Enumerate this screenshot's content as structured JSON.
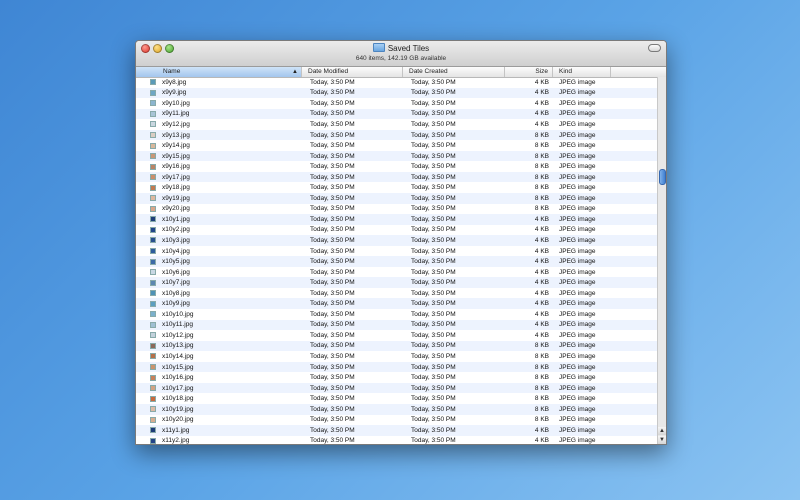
{
  "window": {
    "title": "Saved Tiles",
    "status": "640 items, 142.19 GB available"
  },
  "columns": {
    "name": "Name",
    "modified": "Date Modified",
    "created": "Date Created",
    "size": "Size",
    "kind": "Kind"
  },
  "rows": [
    {
      "name": "x9y8.jpg",
      "modified": "Today, 3:50 PM",
      "created": "Today, 3:50 PM",
      "size": "4 KB",
      "kind": "JPEG image",
      "color": "#5a9ab8"
    },
    {
      "name": "x9y9.jpg",
      "modified": "Today, 3:50 PM",
      "created": "Today, 3:50 PM",
      "size": "4 KB",
      "kind": "JPEG image",
      "color": "#6ea7c4"
    },
    {
      "name": "x9y10.jpg",
      "modified": "Today, 3:50 PM",
      "created": "Today, 3:50 PM",
      "size": "4 KB",
      "kind": "JPEG image",
      "color": "#8bb5cf"
    },
    {
      "name": "x9y11.jpg",
      "modified": "Today, 3:50 PM",
      "created": "Today, 3:50 PM",
      "size": "4 KB",
      "kind": "JPEG image",
      "color": "#a8c4d6"
    },
    {
      "name": "x9y12.jpg",
      "modified": "Today, 3:50 PM",
      "created": "Today, 3:50 PM",
      "size": "4 KB",
      "kind": "JPEG image",
      "color": "#c9d6df"
    },
    {
      "name": "x9y13.jpg",
      "modified": "Today, 3:50 PM",
      "created": "Today, 3:50 PM",
      "size": "8 KB",
      "kind": "JPEG image",
      "color": "#d9cdc3"
    },
    {
      "name": "x9y14.jpg",
      "modified": "Today, 3:50 PM",
      "created": "Today, 3:50 PM",
      "size": "8 KB",
      "kind": "JPEG image",
      "color": "#d7b89c"
    },
    {
      "name": "x9y15.jpg",
      "modified": "Today, 3:50 PM",
      "created": "Today, 3:50 PM",
      "size": "8 KB",
      "kind": "JPEG image",
      "color": "#c79878"
    },
    {
      "name": "x9y16.jpg",
      "modified": "Today, 3:50 PM",
      "created": "Today, 3:50 PM",
      "size": "8 KB",
      "kind": "JPEG image",
      "color": "#b98466"
    },
    {
      "name": "x9y17.jpg",
      "modified": "Today, 3:50 PM",
      "created": "Today, 3:50 PM",
      "size": "8 KB",
      "kind": "JPEG image",
      "color": "#c98e6c"
    },
    {
      "name": "x9y18.jpg",
      "modified": "Today, 3:50 PM",
      "created": "Today, 3:50 PM",
      "size": "8 KB",
      "kind": "JPEG image",
      "color": "#c07a52"
    },
    {
      "name": "x9y19.jpg",
      "modified": "Today, 3:50 PM",
      "created": "Today, 3:50 PM",
      "size": "8 KB",
      "kind": "JPEG image",
      "color": "#dcb8a0"
    },
    {
      "name": "x9y20.jpg",
      "modified": "Today, 3:50 PM",
      "created": "Today, 3:50 PM",
      "size": "8 KB",
      "kind": "JPEG image",
      "color": "#d9a68a"
    },
    {
      "name": "x10y1.jpg",
      "modified": "Today, 3:50 PM",
      "created": "Today, 3:50 PM",
      "size": "4 KB",
      "kind": "JPEG image",
      "color": "#1f3f7a"
    },
    {
      "name": "x10y2.jpg",
      "modified": "Today, 3:50 PM",
      "created": "Today, 3:50 PM",
      "size": "4 KB",
      "kind": "JPEG image",
      "color": "#22468a"
    },
    {
      "name": "x10y3.jpg",
      "modified": "Today, 3:50 PM",
      "created": "Today, 3:50 PM",
      "size": "4 KB",
      "kind": "JPEG image",
      "color": "#28508f"
    },
    {
      "name": "x10y4.jpg",
      "modified": "Today, 3:50 PM",
      "created": "Today, 3:50 PM",
      "size": "4 KB",
      "kind": "JPEG image",
      "color": "#2e5d9c"
    },
    {
      "name": "x10y5.jpg",
      "modified": "Today, 3:50 PM",
      "created": "Today, 3:50 PM",
      "size": "4 KB",
      "kind": "JPEG image",
      "color": "#3b6aa6"
    },
    {
      "name": "x10y6.jpg",
      "modified": "Today, 3:50 PM",
      "created": "Today, 3:50 PM",
      "size": "4 KB",
      "kind": "JPEG image",
      "color": "#c8d8e4"
    },
    {
      "name": "x10y7.jpg",
      "modified": "Today, 3:50 PM",
      "created": "Today, 3:50 PM",
      "size": "4 KB",
      "kind": "JPEG image",
      "color": "#5d88b0"
    },
    {
      "name": "x10y8.jpg",
      "modified": "Today, 3:50 PM",
      "created": "Today, 3:50 PM",
      "size": "4 KB",
      "kind": "JPEG image",
      "color": "#4e92b5"
    },
    {
      "name": "x10y9.jpg",
      "modified": "Today, 3:50 PM",
      "created": "Today, 3:50 PM",
      "size": "4 KB",
      "kind": "JPEG image",
      "color": "#5c9fc0"
    },
    {
      "name": "x10y10.jpg",
      "modified": "Today, 3:50 PM",
      "created": "Today, 3:50 PM",
      "size": "4 KB",
      "kind": "JPEG image",
      "color": "#7bb0cc"
    },
    {
      "name": "x10y11.jpg",
      "modified": "Today, 3:50 PM",
      "created": "Today, 3:50 PM",
      "size": "4 KB",
      "kind": "JPEG image",
      "color": "#9ebfd3"
    },
    {
      "name": "x10y12.jpg",
      "modified": "Today, 3:50 PM",
      "created": "Today, 3:50 PM",
      "size": "4 KB",
      "kind": "JPEG image",
      "color": "#c2d1db"
    },
    {
      "name": "x10y13.jpg",
      "modified": "Today, 3:50 PM",
      "created": "Today, 3:50 PM",
      "size": "8 KB",
      "kind": "JPEG image",
      "color": "#8b6a5a"
    },
    {
      "name": "x10y14.jpg",
      "modified": "Today, 3:50 PM",
      "created": "Today, 3:50 PM",
      "size": "8 KB",
      "kind": "JPEG image",
      "color": "#b5714a"
    },
    {
      "name": "x10y15.jpg",
      "modified": "Today, 3:50 PM",
      "created": "Today, 3:50 PM",
      "size": "8 KB",
      "kind": "JPEG image",
      "color": "#c9946e"
    },
    {
      "name": "x10y16.jpg",
      "modified": "Today, 3:50 PM",
      "created": "Today, 3:50 PM",
      "size": "8 KB",
      "kind": "JPEG image",
      "color": "#c6815c"
    },
    {
      "name": "x10y17.jpg",
      "modified": "Today, 3:50 PM",
      "created": "Today, 3:50 PM",
      "size": "8 KB",
      "kind": "JPEG image",
      "color": "#d0a385"
    },
    {
      "name": "x10y18.jpg",
      "modified": "Today, 3:50 PM",
      "created": "Today, 3:50 PM",
      "size": "8 KB",
      "kind": "JPEG image",
      "color": "#c86a3e"
    },
    {
      "name": "x10y19.jpg",
      "modified": "Today, 3:50 PM",
      "created": "Today, 3:50 PM",
      "size": "8 KB",
      "kind": "JPEG image",
      "color": "#dbbba6"
    },
    {
      "name": "x10y20.jpg",
      "modified": "Today, 3:50 PM",
      "created": "Today, 3:50 PM",
      "size": "8 KB",
      "kind": "JPEG image",
      "color": "#d6ad90"
    },
    {
      "name": "x11y1.jpg",
      "modified": "Today, 3:50 PM",
      "created": "Today, 3:50 PM",
      "size": "4 KB",
      "kind": "JPEG image",
      "color": "#1d3c78"
    },
    {
      "name": "x11y2.jpg",
      "modified": "Today, 3:50 PM",
      "created": "Today, 3:50 PM",
      "size": "4 KB",
      "kind": "JPEG image",
      "color": "#234488"
    }
  ]
}
